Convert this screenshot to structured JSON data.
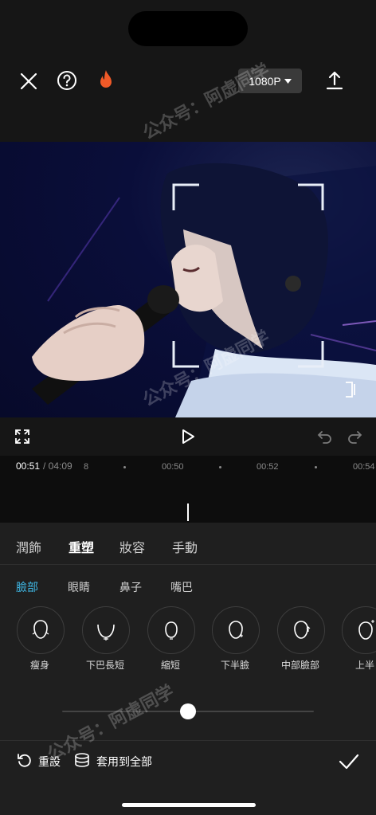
{
  "header": {
    "resolution_label": "1080P",
    "icons": [
      "close-icon",
      "help-icon",
      "fire-icon",
      "export-icon"
    ]
  },
  "playback": {
    "current_time": "00:51",
    "total_time": "/ 04:09",
    "ticks": [
      "8",
      "00:50",
      "00:52",
      "00:54"
    ]
  },
  "tabs": [
    {
      "label": "潤飾",
      "active": false
    },
    {
      "label": "重塑",
      "active": true
    },
    {
      "label": "妝容",
      "active": false
    },
    {
      "label": "手動",
      "active": false
    }
  ],
  "subtabs": [
    {
      "label": "臉部",
      "active": true
    },
    {
      "label": "眼睛",
      "active": false
    },
    {
      "label": "鼻子",
      "active": false
    },
    {
      "label": "嘴巴",
      "active": false
    }
  ],
  "items": [
    {
      "label": "瘦身"
    },
    {
      "label": "下巴長短"
    },
    {
      "label": "縮短"
    },
    {
      "label": "下半臉"
    },
    {
      "label": "中部臉部"
    },
    {
      "label": "上半"
    }
  ],
  "slider": {
    "value": 0.5
  },
  "bottom": {
    "reset_label": "重設",
    "apply_all_label": "套用到全部"
  },
  "watermark": "公众号：阿虚同学",
  "colors": {
    "accent": "#3fb8e6",
    "flame": "#f05a28"
  }
}
